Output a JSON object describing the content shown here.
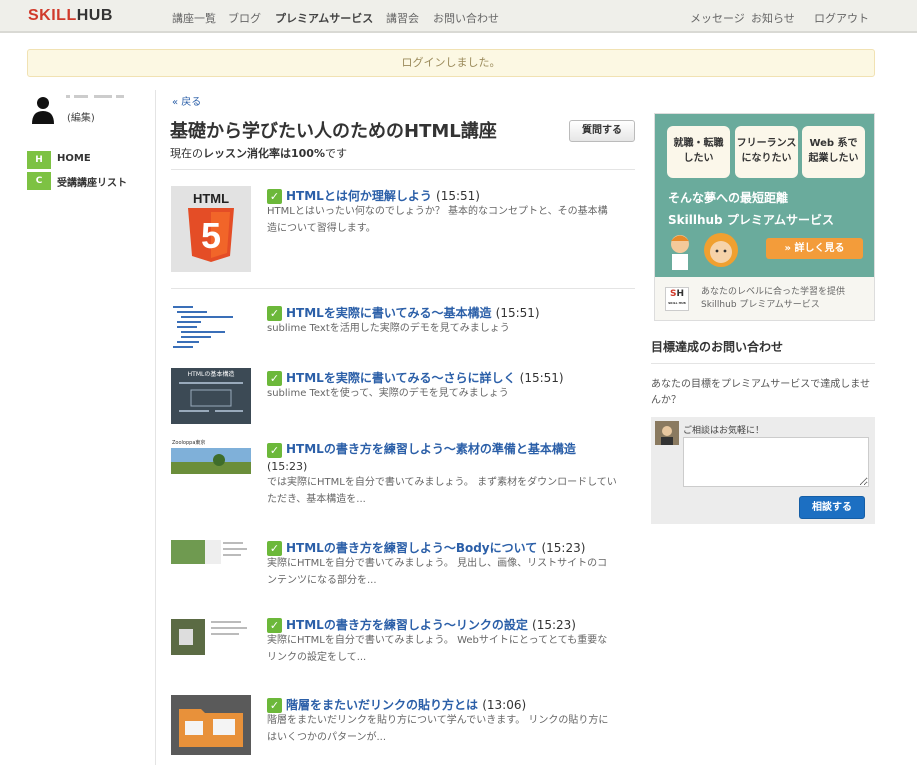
{
  "header": {
    "logo_skill": "SKILL",
    "logo_hub": "HUB",
    "nav": [
      "講座一覧",
      "ブログ",
      "プレミアムサービス",
      "講習会",
      "お問い合わせ"
    ],
    "right_nav": [
      "メッセージ",
      "お知らせ",
      "ログアウト"
    ]
  },
  "alert": {
    "text": "ログインしました。"
  },
  "sidebar": {
    "user_edit": "(編集)",
    "items": [
      {
        "badge": "H",
        "label": "HOME"
      },
      {
        "badge": "C",
        "label": "受講講座リスト"
      }
    ]
  },
  "main": {
    "back": "« 戻る",
    "title": "基礎から学びたい人のためのHTML講座",
    "progress_prefix": "現在の",
    "progress_bold": "レッスン消化率は100%",
    "progress_suffix": "です",
    "ask_button": "質問する",
    "lessons": [
      {
        "title": "HTMLとは何か理解しよう",
        "duration": "(15:51)",
        "desc": "HTMLとはいったい何なのでしょうか？ 基本的なコンセプトと、その基本構造について習得します。"
      },
      {
        "title": "HTMLを実際に書いてみる〜基本構造",
        "duration": "(15:51)",
        "desc": "sublime Textを活用した実際のデモを見てみましょう"
      },
      {
        "title": "HTMLを実際に書いてみる〜さらに詳しく",
        "duration": "(15:51)",
        "desc": "sublime Textを使って、実際のデモを見てみましょう"
      },
      {
        "title": "HTMLの書き方を練習しよう〜素材の準備と基本構造",
        "duration": "(15:23)",
        "desc": "では実際にHTMLを自分で書いてみましょう。 まず素材をダウンロードしていただき、基本構造を..."
      },
      {
        "title": "HTMLの書き方を練習しよう〜Bodyについて",
        "duration": "(15:23)",
        "desc": "実際にHTMLを自分で書いてみましょう。 見出し、画像、リストサイトのコンテンツになる部分を..."
      },
      {
        "title": "HTMLの書き方を練習しよう〜リンクの設定",
        "duration": "(15:23)",
        "desc": "実際にHTMLを自分で書いてみましょう。 Webサイトにとってとても重要なリンクの設定をして..."
      },
      {
        "title": "階層をまたいだリンクの貼り方とは",
        "duration": "(13:06)",
        "desc": "階層をまたいだリンクを貼り方について学んでいきます。 リンクの貼り方にはいくつかのパターンが..."
      }
    ],
    "thumbs": {
      "html5_label": "HTML",
      "html5_number": "5",
      "slide3_title": "HTMLの基本構造",
      "slide4_brand": "Zooloppa東京"
    }
  },
  "promo": {
    "pills": [
      "就職・転職\nしたい",
      "フリーランス\nになりたい",
      "Web 系で\n起業したい"
    ],
    "main_line1": "そんな夢への最短距離",
    "main_line2": "Skillhub プレミアムサービス",
    "button": "» 詳しく見る",
    "sh_logo_s": "S",
    "sh_logo_h": "H",
    "sh_logo_sub": "SKILL HUB",
    "sub_line1": "あなたのレベルに合った学習を提供",
    "sub_line2": "Skillhub プレミアムサービス"
  },
  "goal": {
    "heading": "目標達成のお問い合わせ",
    "text": "あなたの目標をプレミアムサービスで達成しませんか？",
    "label": "ご相談はお気軽に！",
    "button": "相談する"
  },
  "colors": {
    "accent_green": "#7dc243",
    "link_blue": "#2b5fa8",
    "logo_red": "#d03a2b",
    "promo_teal": "#6aab9c",
    "button_blue": "#1c6fc2"
  }
}
